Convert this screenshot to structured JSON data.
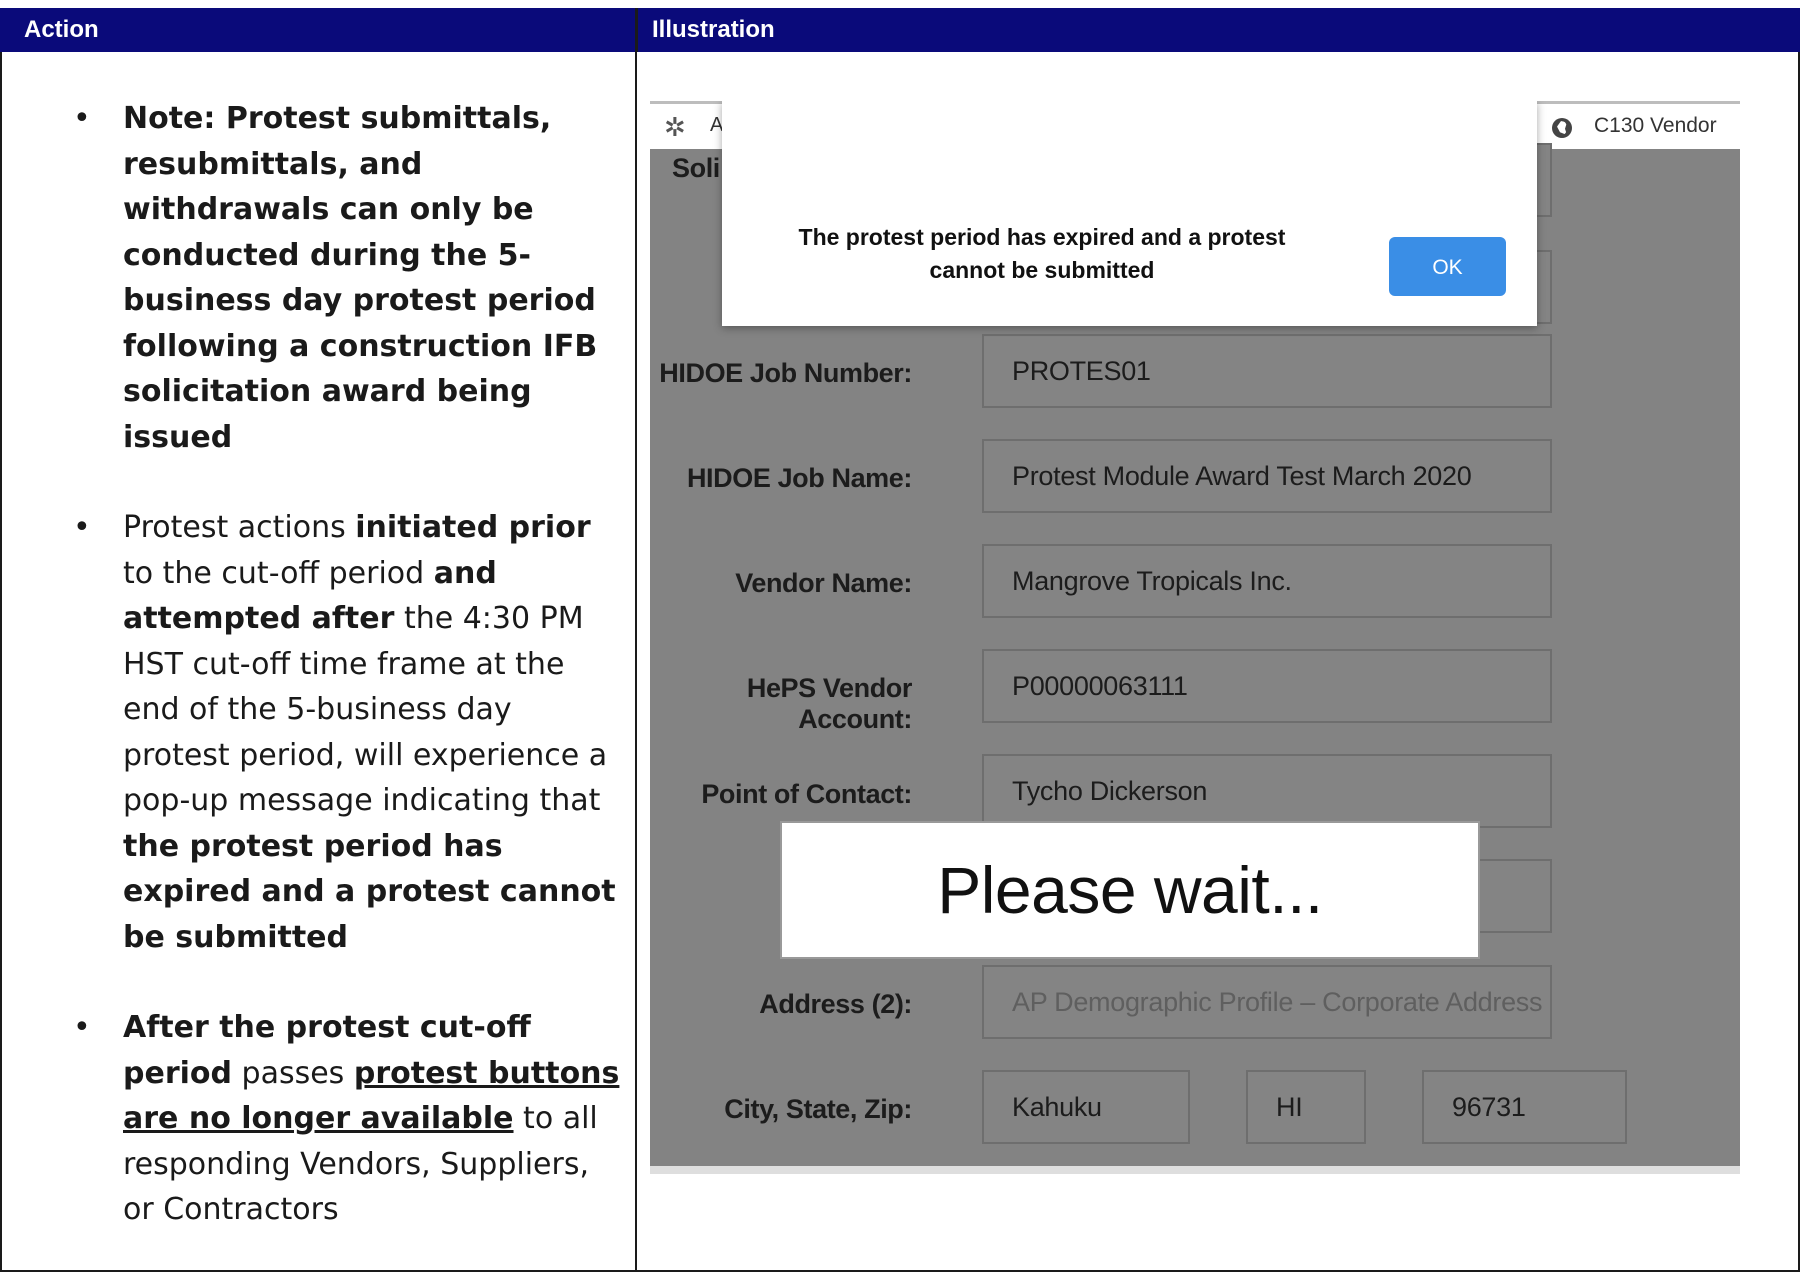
{
  "table": {
    "headers": {
      "action": "Action",
      "illustration": "Illustration"
    }
  },
  "bullets": {
    "b1": {
      "t1": "Note: Protest submittals, resubmittals, and withdrawals can only be conducted during the 5- business day protest period following a construction IFB solicitation award being issued"
    },
    "b2": {
      "t1": "Protest actions ",
      "t2": "initiated prior",
      "t3": " to the cut-off period ",
      "t4": "and attempted after",
      "t5": " the 4:30 PM HST cut-off time frame at the end of the 5-business day protest period, will experience a pop-up message indicating that ",
      "t6": "the protest period has expired and a protest cannot be submitted"
    },
    "b3": {
      "t1": "After the protest cut-off period",
      "t2": " passes ",
      "t3": "protest buttons are no longer available",
      "t4": " to all responding Vendors, Suppliers, or Contractors"
    }
  },
  "screenshot": {
    "topbar": {
      "logo_icon": "pinwheel-logo-icon",
      "logo_letter": "A",
      "user_icon": "globe-icon",
      "user_label": "C130 Vendor"
    },
    "dialog": {
      "message": "The protest period has expired and a protest cannot be submitted",
      "ok_label": "OK"
    },
    "form": {
      "solicitation_label_partial": "Soli",
      "job_number_label": "HIDOE Job Number:",
      "job_number_value": "PROTES01",
      "job_name_label": "HIDOE Job Name:",
      "job_name_value": "Protest Module Award Test March 2020",
      "vendor_name_label": "Vendor Name:",
      "vendor_name_value": "Mangrove Tropicals Inc.",
      "heps_account_label": "HePS Vendor Account:",
      "heps_account_value": "P00000063111",
      "contact_label_partial": "Point of Contact:",
      "contact_value_partial": "Tycho Dickerson",
      "address2_label": "Address (2):",
      "address2_placeholder": "AP Demographic Profile – Corporate Address if ad",
      "city_label": "City, State, Zip:",
      "city_value": "Kahuku",
      "state_value": "HI",
      "zip_value": "96731"
    },
    "overlay": {
      "text": "Please wait..."
    }
  }
}
